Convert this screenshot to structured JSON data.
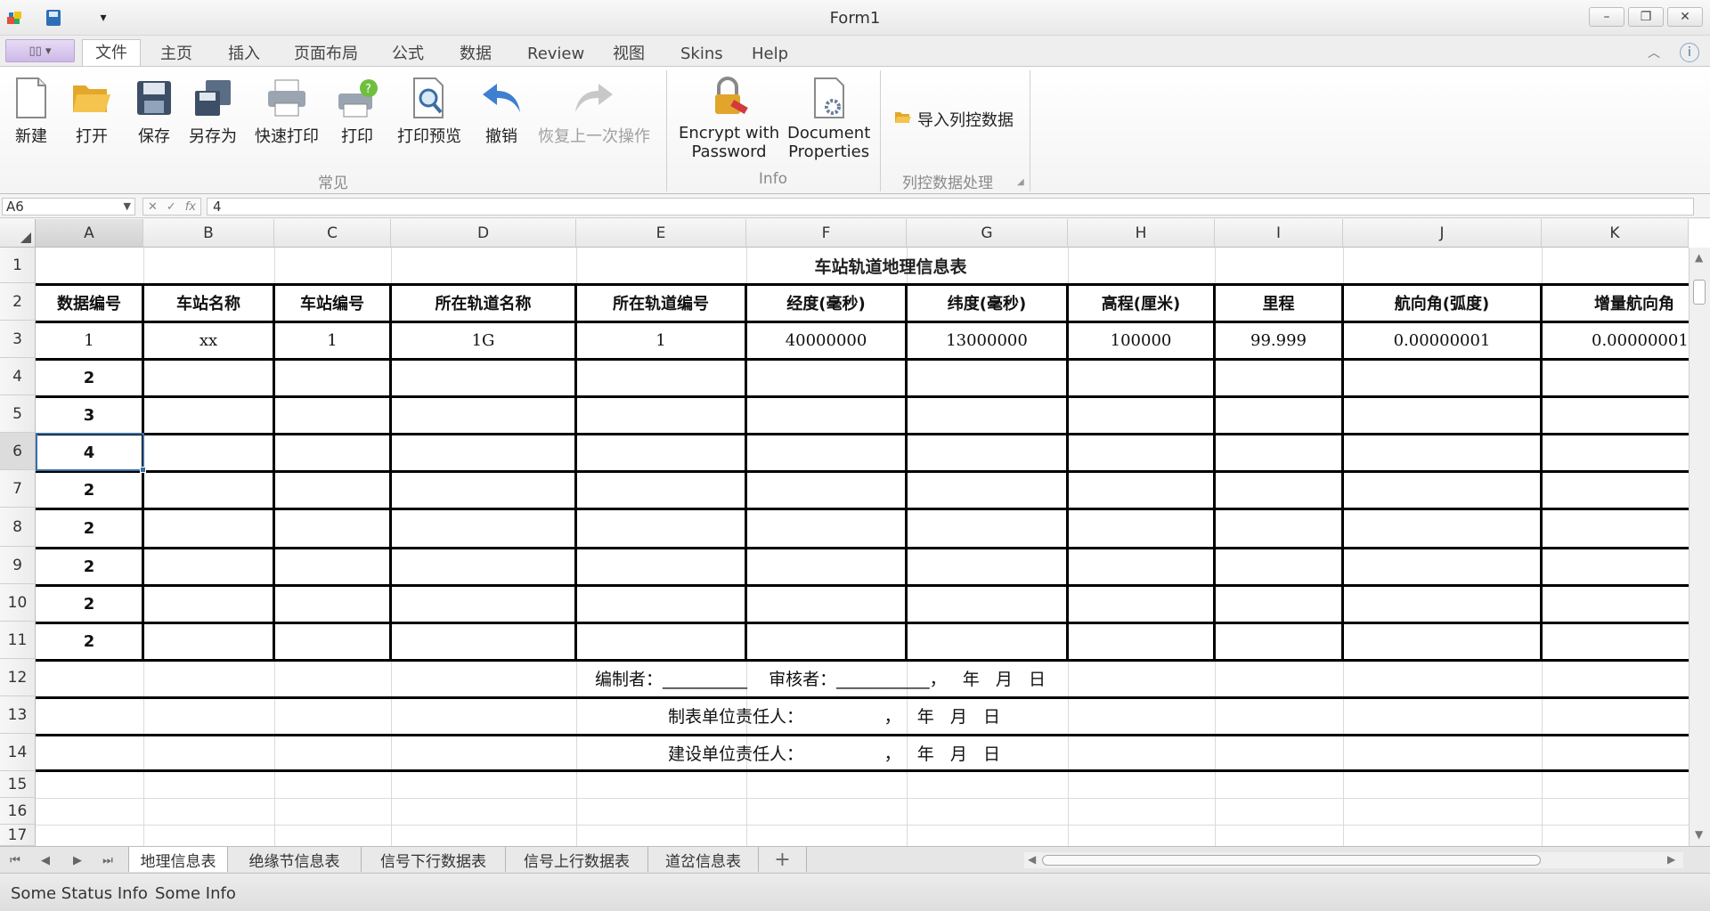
{
  "window": {
    "title": "Form1"
  },
  "menu": {
    "tabs": [
      "文件",
      "主页",
      "插入",
      "页面布局",
      "公式",
      "数据",
      "Review",
      "视图",
      "Skins",
      "Help"
    ],
    "active_tab": "文件"
  },
  "ribbon": {
    "common": {
      "label": "常见",
      "buttons": [
        "新建",
        "打开",
        "保存",
        "另存为",
        "快速打印",
        "打印",
        "打印预览",
        "撤销",
        "恢复上一次操作"
      ]
    },
    "info": {
      "label": "Info",
      "encrypt": [
        "Encrypt with",
        "Password"
      ],
      "docprops": [
        "Document",
        "Properties"
      ]
    },
    "column_control": {
      "label": "列控数据处理",
      "import_label": "导入列控数据"
    }
  },
  "formula_bar": {
    "name_box": "A6",
    "formula": "4"
  },
  "grid": {
    "columns": [
      "A",
      "B",
      "C",
      "D",
      "E",
      "F",
      "G",
      "H",
      "I",
      "J",
      "K"
    ],
    "rows": [
      "1",
      "2",
      "3",
      "4",
      "5",
      "6",
      "7",
      "8",
      "9",
      "10",
      "11",
      "12",
      "13",
      "14",
      "15",
      "16",
      "17"
    ],
    "sheet_title": "车站轨道地理信息表",
    "headers": [
      "数据编号",
      "车站名称",
      "车站编号",
      "所在轨道名称",
      "所在轨道编号",
      "经度(毫秒)",
      "纬度(毫秒)",
      "高程(厘米)",
      "里程",
      "航向角(弧度)",
      "增量航向角"
    ],
    "data_row": [
      "1",
      "xx",
      "1",
      "1G",
      "1",
      "40000000",
      "13000000",
      "100000",
      "99.999",
      "0.00000001",
      "0.00000001"
    ],
    "ids": [
      "2",
      "3",
      "4",
      "2",
      "2",
      "2",
      "2",
      "2"
    ],
    "footer": {
      "row12": "编制者：__________    审核者：___________，   年   月   日",
      "row13": "制表单位责任人：               ，   年   月   日",
      "row14": "建设单位责任人：               ，   年   月   日"
    }
  },
  "sheet_tabs": [
    "地理信息表",
    "绝缘节信息表",
    "信号下行数据表",
    "信号上行数据表",
    "道岔信息表",
    "+"
  ],
  "status": {
    "left": "Some Status Info",
    "right": "Some Info"
  },
  "colors": {
    "selection": "#3a6ea5",
    "ribbon_label": "#8a8a8a"
  }
}
